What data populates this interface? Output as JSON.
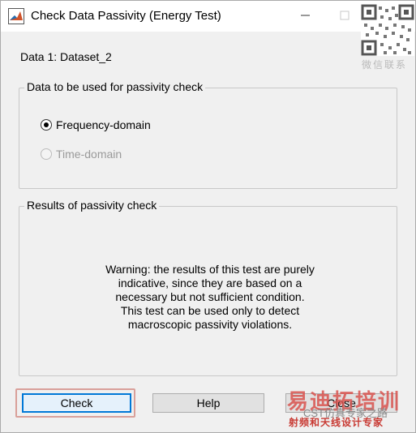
{
  "window": {
    "title": "Check Data Passivity (Energy Test)"
  },
  "dataset_label": "Data 1: Dataset_2",
  "group_passivity": {
    "title": "Data to be used for passivity check",
    "options": [
      {
        "label": "Frequency-domain",
        "selected": true,
        "enabled": true
      },
      {
        "label": "Time-domain",
        "selected": false,
        "enabled": false
      }
    ]
  },
  "group_results": {
    "title": "Results of passivity check",
    "warning_lines": [
      "Warning: the results of this test are purely",
      "indicative, since they are based on a",
      "necessary but not sufficient condition.",
      "This test can be used only to detect",
      "macroscopic passivity violations."
    ]
  },
  "buttons": {
    "check": "Check",
    "help": "Help",
    "close": "Close"
  },
  "watermark": {
    "follow": "微信联系",
    "brand": "易迪拓培训",
    "cst": "CST仿真专家之路",
    "subtitle": "射频和天线设计专家"
  },
  "colors": {
    "accent": "#0078d7",
    "highlight": "#d9a09a",
    "brand": "#d9534f"
  }
}
